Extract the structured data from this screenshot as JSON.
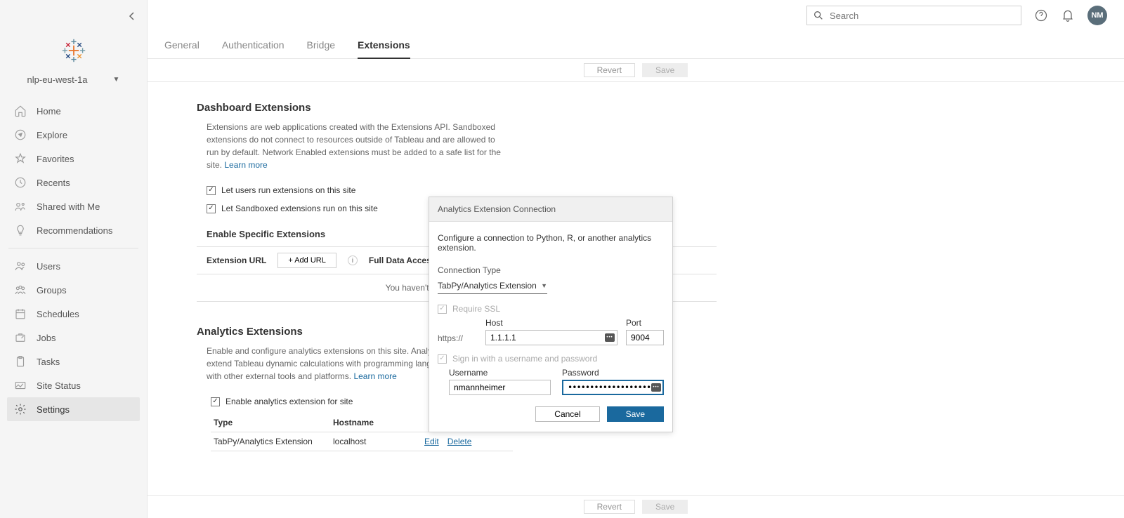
{
  "site_name": "nlp-eu-west-1a",
  "search_placeholder": "Search",
  "avatar_initials": "NM",
  "sidebar": {
    "items": [
      {
        "label": "Home"
      },
      {
        "label": "Explore"
      },
      {
        "label": "Favorites"
      },
      {
        "label": "Recents"
      },
      {
        "label": "Shared with Me"
      },
      {
        "label": "Recommendations"
      },
      {
        "label": "Users"
      },
      {
        "label": "Groups"
      },
      {
        "label": "Schedules"
      },
      {
        "label": "Jobs"
      },
      {
        "label": "Tasks"
      },
      {
        "label": "Site Status"
      },
      {
        "label": "Settings"
      }
    ]
  },
  "tabs": {
    "general": "General",
    "authentication": "Authentication",
    "bridge": "Bridge",
    "extensions": "Extensions"
  },
  "actions": {
    "revert": "Revert",
    "save": "Save"
  },
  "dashboard_extensions": {
    "title": "Dashboard Extensions",
    "desc": "Extensions are web applications created with the Extensions API. Sandboxed extensions do not connect to resources outside of Tableau and are allowed to run by default. Network Enabled extensions must be added to a safe list for the site.  ",
    "learn_more": "Learn more",
    "check1": "Let users run extensions on this site",
    "check2": "Let Sandboxed extensions run on this site",
    "enable_specific": "Enable Specific Extensions",
    "extension_url": "Extension URL",
    "add_url": "+ Add URL",
    "full_data": "Full Data Access",
    "empty": "You haven't safelisted any extensions."
  },
  "analytics_extensions": {
    "title": "Analytics Extensions",
    "desc": "Enable and configure analytics extensions on this site. Analytics extensions allow you to extend Tableau dynamic calculations with programming languages like R and Python, and with other external tools and platforms.  ",
    "learn_more": "Learn more",
    "enable_check": "Enable analytics extension for site",
    "col_type": "Type",
    "col_hostname": "Hostname",
    "row_type": "TabPy/Analytics Extension",
    "row_hostname": "localhost",
    "edit": "Edit",
    "delete": "Delete"
  },
  "modal": {
    "title": "Analytics Extension Connection",
    "desc": "Configure a connection to Python, R, or another analytics extension.",
    "conn_type_label": "Connection Type",
    "conn_type_value": "TabPy/Analytics Extension",
    "require_ssl": "Require SSL",
    "https": "https://",
    "host_label": "Host",
    "host_value": "1.1.1.1",
    "port_label": "Port",
    "port_value": "9004",
    "signin": "Sign in with a username and password",
    "username_label": "Username",
    "username_value": "nmannheimer",
    "password_label": "Password",
    "password_value": "•••••••••••••••••••",
    "cancel": "Cancel",
    "save": "Save"
  }
}
